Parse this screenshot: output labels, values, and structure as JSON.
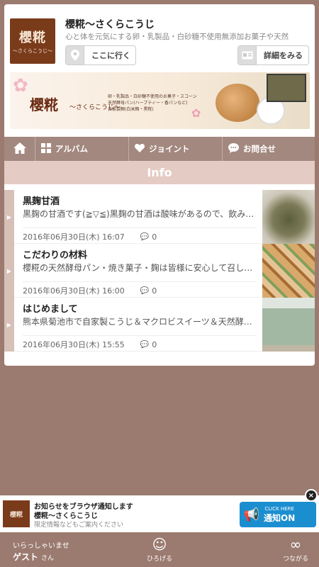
{
  "shop": {
    "logo_text": "櫻糀",
    "logo_sub": "〜さくらこうじ〜",
    "title": "櫻糀〜さくらこうじ",
    "subtitle": "心と体を元気にする卵・乳製品・白砂糖不使用無添加お菓子や天然",
    "go_button": "ここに行く",
    "detail_button": "詳細をみる"
  },
  "banner": {
    "title": "櫻糀",
    "sub": "〜さくらこうじ〜",
    "text": "卵・乳製品・白砂糖不使用のお菓子・スコーン\n天然酵母パン(ハーブティー・香パンなど)\n自家製麹(白米麹・黒糀)"
  },
  "tabs": {
    "album": "アルバム",
    "joint": "ジョイント",
    "contact": "お問合せ"
  },
  "section_title": "Info",
  "posts": [
    {
      "title": "黒麹甘酒",
      "snippet": "黒麹の甘酒です(≧▽≦)黒麹の甘酒は酸味があるので、飲みやすい",
      "date": "2016年06月30日(木) 16:07",
      "comments": "0"
    },
    {
      "title": "こだわりの材料",
      "snippet": "櫻糀の天然酵母パン・焼き菓子・麹は皆様に安心して召し上がって",
      "date": "2016年06月30日(木) 16:00",
      "comments": "0"
    },
    {
      "title": "はじめまして",
      "snippet": "熊本県菊池市で自家製こうじ＆マクロビスイーツ＆天然酵母パン",
      "date": "2016年06月30日(木) 15:55",
      "comments": "0"
    }
  ],
  "notify": {
    "logo_text": "櫻糀",
    "line1": "お知らせをブラウザ通知します",
    "line2": "櫻糀〜さくらこうじ",
    "line3": "限定情報などもご案内ください",
    "btn_small": "CLICK HERE",
    "btn_main": "通知ON",
    "close": "×"
  },
  "bottom": {
    "welcome": "いらっしゃいませ",
    "guest": "ゲスト",
    "guest_suffix": "さん",
    "open_label": "ひろげる",
    "connect_label": "つながる"
  },
  "colors": {
    "background": "#9b7a6f",
    "tab_bar": "#a3887f",
    "info_bar": "#e4cbc3",
    "stripe": "#d7c0b8",
    "notify_button": "#1b8ed0"
  }
}
